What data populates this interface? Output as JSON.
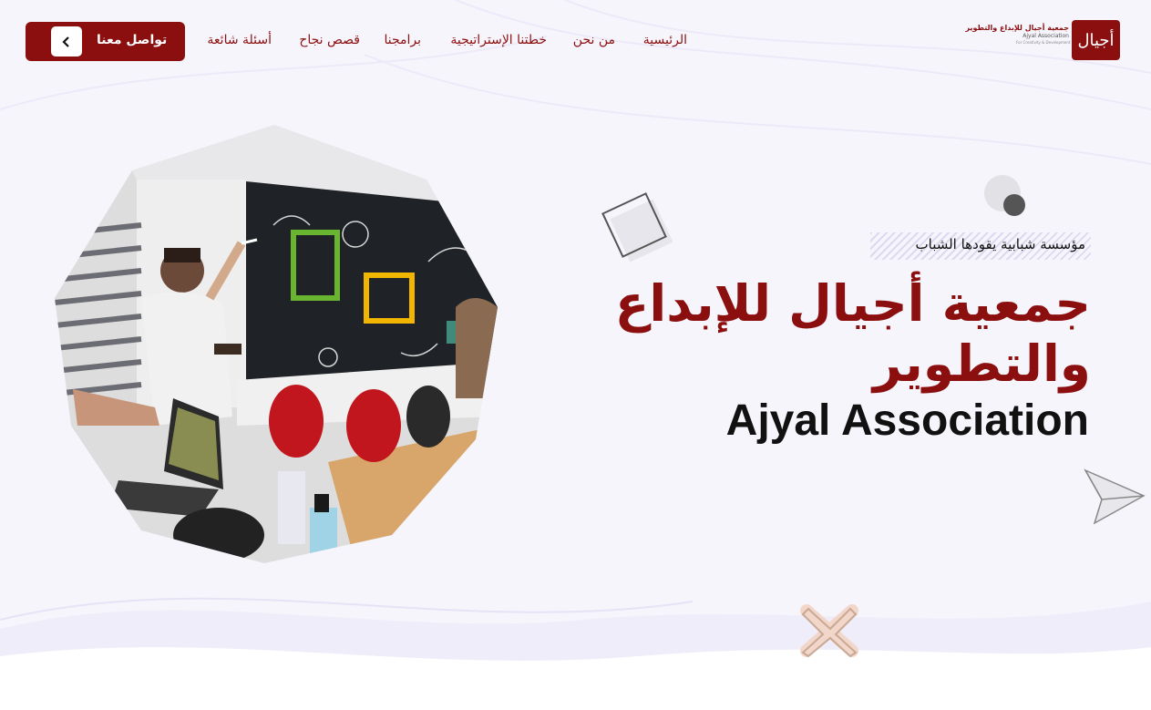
{
  "brand": {
    "logo_mark": "أجيال",
    "name_ar": "جمعية أجيال للإبداع والتطوير",
    "name_en": "Ajyal Association",
    "tagline_en": "For Creativity & Development"
  },
  "nav": {
    "items": [
      {
        "label": "الرئيسية"
      },
      {
        "label": "من نحن"
      },
      {
        "label": "خطتنا الإستراتيجية"
      },
      {
        "label": "برامجنا"
      },
      {
        "label": "قصص نجاح"
      },
      {
        "label": "أسئلة شائعة"
      }
    ],
    "cta_label": "تواصل معنا"
  },
  "hero": {
    "tagline": "مؤسسة شبابية يقودها الشباب",
    "title_ar": "جمعية أجيال للإبداع والتطوير",
    "title_en": "Ajyal Association"
  },
  "colors": {
    "brand": "#8c0f0f",
    "background": "#f6f5fc"
  },
  "icons": {
    "cta": "chevron-left-icon",
    "decorations": [
      "square-outline-icon",
      "circle-icon",
      "paper-plane-icon",
      "x-cross-icon"
    ]
  }
}
